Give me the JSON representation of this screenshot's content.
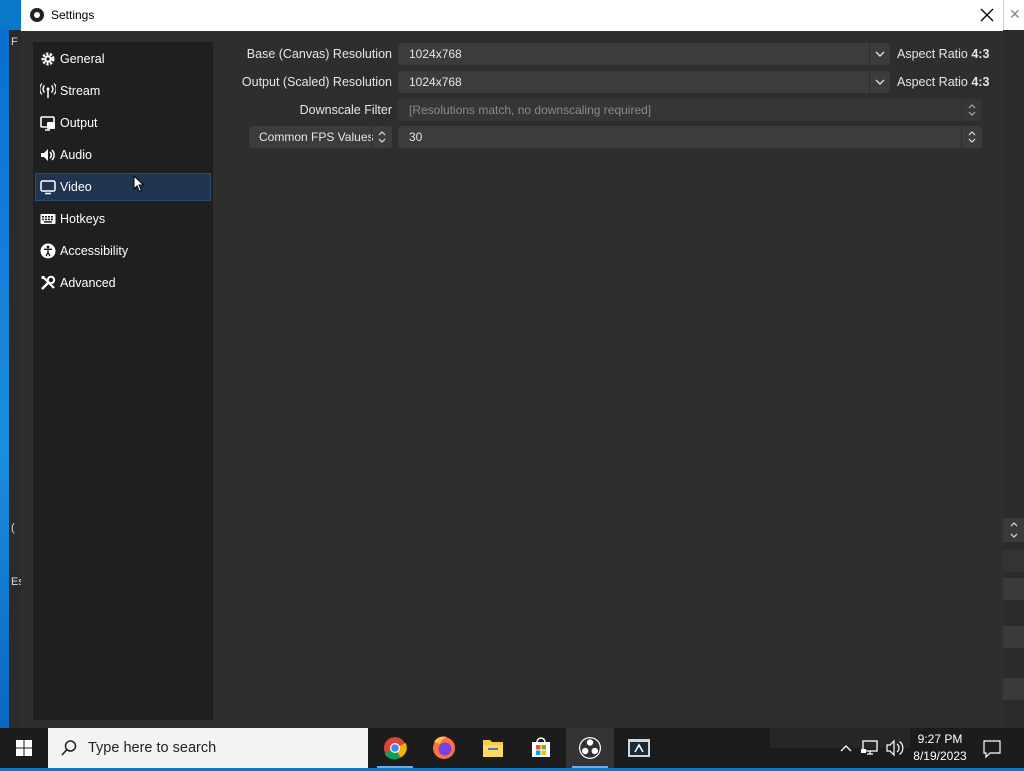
{
  "background_window": {
    "left_texts": [
      "F",
      "(",
      "Es"
    ],
    "close_glyph": "✕"
  },
  "dialog": {
    "title": "Settings",
    "close_glyph": "✕"
  },
  "sidebar": {
    "items": [
      {
        "label": "General",
        "icon": "gear-icon"
      },
      {
        "label": "Stream",
        "icon": "antenna-icon"
      },
      {
        "label": "Output",
        "icon": "output-icon"
      },
      {
        "label": "Audio",
        "icon": "speaker-icon"
      },
      {
        "label": "Video",
        "icon": "monitor-icon",
        "active": true
      },
      {
        "label": "Hotkeys",
        "icon": "keyboard-icon"
      },
      {
        "label": "Accessibility",
        "icon": "accessibility-icon"
      },
      {
        "label": "Advanced",
        "icon": "tools-icon"
      }
    ]
  },
  "video": {
    "base_resolution": {
      "label": "Base (Canvas) Resolution",
      "value": "1024x768",
      "aspect_prefix": "Aspect Ratio",
      "aspect_value": "4:3"
    },
    "output_resolution": {
      "label": "Output (Scaled) Resolution",
      "value": "1024x768",
      "aspect_prefix": "Aspect Ratio",
      "aspect_value": "4:3"
    },
    "downscale_filter": {
      "label": "Downscale Filter",
      "value": "[Resolutions match, no downscaling required]"
    },
    "fps": {
      "label": "Common FPS Values",
      "value": "30"
    }
  },
  "taskbar": {
    "search_placeholder": "Type here to search",
    "apps": [
      "chrome-icon",
      "firefox-icon",
      "file-explorer-icon",
      "store-icon",
      "obs-icon",
      "terminal-app-icon"
    ],
    "time": "9:27 PM",
    "date": "8/19/2023"
  },
  "colors": {
    "dialog_bg": "#2e2e2e",
    "sidebar_bg": "#1f1f1f",
    "active_item": "#20354f",
    "taskbar_bg": "#1c1c1c"
  }
}
